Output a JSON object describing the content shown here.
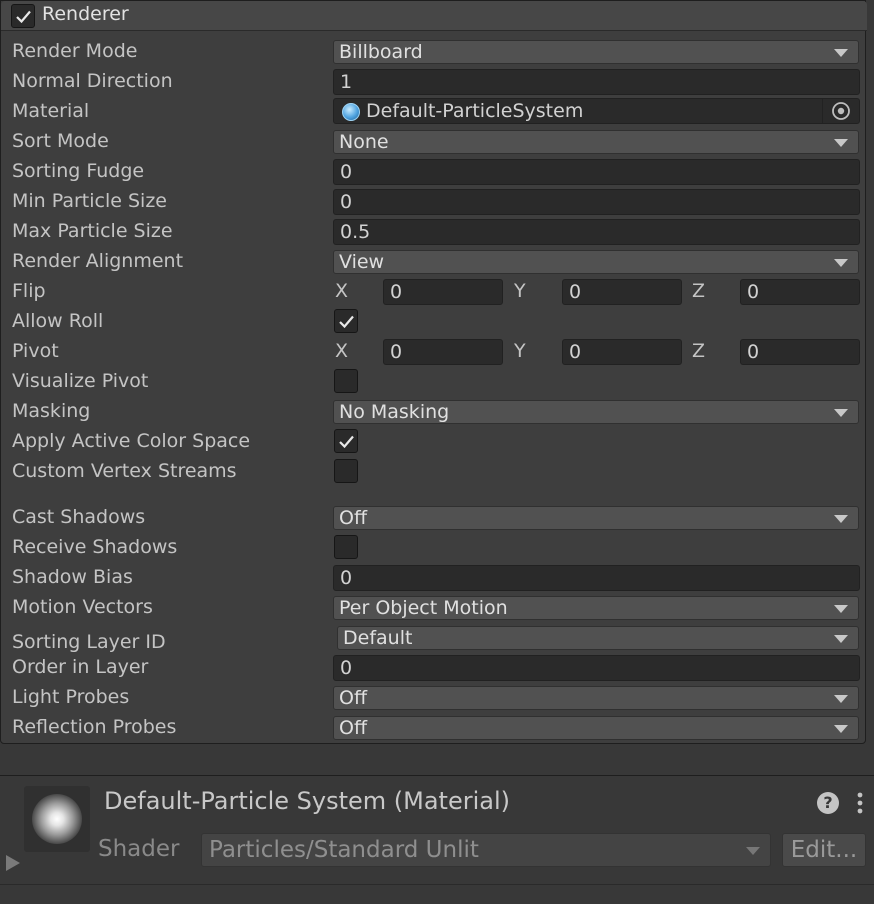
{
  "module": {
    "title": "Renderer",
    "enabled": true
  },
  "rows": {
    "render_mode": {
      "label": "Render Mode",
      "value": "Billboard"
    },
    "normal_direction": {
      "label": "Normal Direction",
      "value": "1"
    },
    "material": {
      "label": "Material",
      "value": "Default-ParticleSystem"
    },
    "sort_mode": {
      "label": "Sort Mode",
      "value": "None"
    },
    "sorting_fudge": {
      "label": "Sorting Fudge",
      "value": "0"
    },
    "min_particle_size": {
      "label": "Min Particle Size",
      "value": "0"
    },
    "max_particle_size": {
      "label": "Max Particle Size",
      "value": "0.5"
    },
    "render_alignment": {
      "label": "Render Alignment",
      "value": "View"
    },
    "flip": {
      "label": "Flip",
      "x": "0",
      "y": "0",
      "z": "0"
    },
    "allow_roll": {
      "label": "Allow Roll",
      "checked": true
    },
    "pivot": {
      "label": "Pivot",
      "x": "0",
      "y": "0",
      "z": "0"
    },
    "visualize_pivot": {
      "label": "Visualize Pivot",
      "checked": false
    },
    "masking": {
      "label": "Masking",
      "value": "No Masking"
    },
    "apply_active_color_space": {
      "label": "Apply Active Color Space",
      "checked": true
    },
    "custom_vertex_streams": {
      "label": "Custom Vertex Streams",
      "checked": false
    },
    "cast_shadows": {
      "label": "Cast Shadows",
      "value": "Off"
    },
    "receive_shadows": {
      "label": "Receive Shadows",
      "checked": false
    },
    "shadow_bias": {
      "label": "Shadow Bias",
      "value": "0"
    },
    "motion_vectors": {
      "label": "Motion Vectors",
      "value": "Per Object Motion"
    },
    "sorting_layer_id": {
      "label": "Sorting Layer ID",
      "value": "Default"
    },
    "order_in_layer": {
      "label": "Order in Layer",
      "value": "0"
    },
    "light_probes": {
      "label": "Light Probes",
      "value": "Off"
    },
    "reflection_probes": {
      "label": "Reflection Probes",
      "value": "Off"
    }
  },
  "axis_labels": {
    "x": "X",
    "y": "Y",
    "z": "Z"
  },
  "material_panel": {
    "title": "Default-Particle System (Material)",
    "shader_label": "Shader",
    "shader_value": "Particles/Standard Unlit",
    "edit_label": "Edit..."
  },
  "icons": {
    "checkmark": "check-icon",
    "dropdown": "chevron-down-icon",
    "material": "material-sphere-icon",
    "object_picker": "object-picker-icon",
    "help": "help-icon",
    "menu": "kebab-menu-icon",
    "foldout": "foldout-arrow-icon"
  },
  "colors": {
    "background": "#383838",
    "module_bg": "#3e3e3e",
    "field_bg": "#2a2a2a",
    "dropdown_bg": "#515151",
    "material_icon": "#4fa3e0"
  }
}
